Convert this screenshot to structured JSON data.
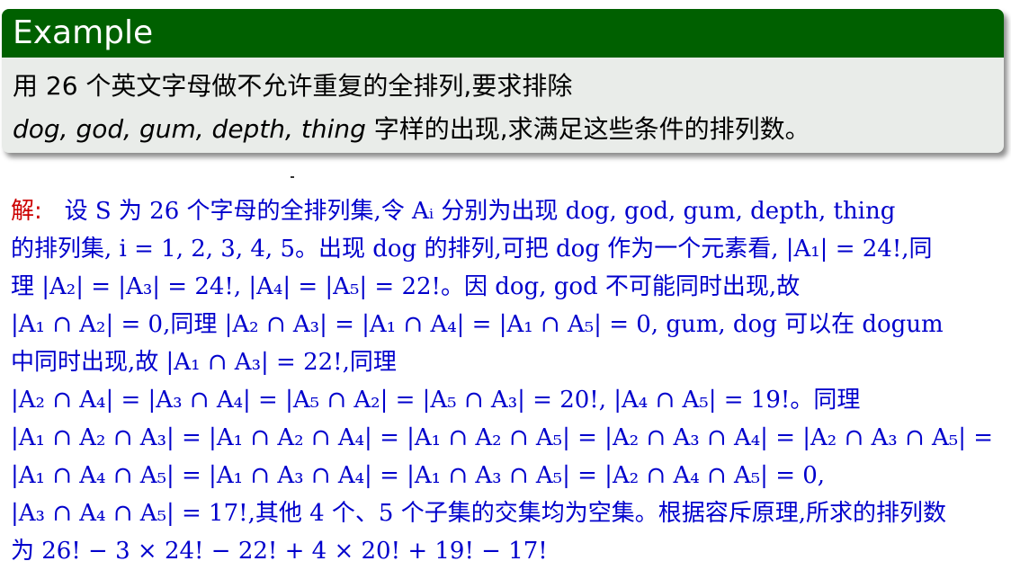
{
  "example": {
    "title": "Example",
    "line1": "用 26 个英文字母做不允许重复的全排列,要求排除",
    "words": "dog, god, gum, depth, thing",
    "line2_rest": " 字样的出现,求满足这些条件的排列数。"
  },
  "solution": {
    "label": "解:",
    "lines": [
      "设 S 为 26 个字母的全排列集,令 Aᵢ 分别为出现 dog, god, gum, depth, thing",
      "的排列集, i = 1, 2, 3, 4, 5。出现 dog 的排列,可把 dog 作为一个元素看, |A₁| = 24!,同",
      "理 |A₂| = |A₃| = 24!, |A₄| = |A₅| = 22!。因 dog, god 不可能同时出现,故",
      "|A₁ ∩ A₂| = 0,同理 |A₂ ∩ A₃| = |A₁ ∩ A₄| = |A₁ ∩ A₅| = 0, gum, dog 可以在 dogum",
      "中同时出现,故 |A₁ ∩ A₃| = 22!,同理",
      "|A₂ ∩ A₄| = |A₃ ∩ A₄| = |A₅ ∩ A₂| = |A₅ ∩ A₃| = 20!, |A₄ ∩ A₅| = 19!。同理",
      "|A₁ ∩ A₂ ∩ A₃| = |A₁ ∩ A₂ ∩ A₄| = |A₁ ∩ A₂ ∩ A₅| = |A₂ ∩ A₃ ∩ A₄| = |A₂ ∩ A₃ ∩ A₅| =",
      "|A₁ ∩ A₄ ∩ A₅| = |A₁ ∩ A₃ ∩ A₄| = |A₁ ∩ A₃ ∩ A₅| = |A₂ ∩ A₄ ∩ A₅| = 0,",
      "|A₃ ∩ A₄ ∩ A₅| = 17!,其他 4 个、5 个子集的交集均为空集。根据容斥原理,所求的排列数",
      "为 26! − 3 × 24! − 22! + 4 × 20! + 19! − 17!"
    ]
  }
}
